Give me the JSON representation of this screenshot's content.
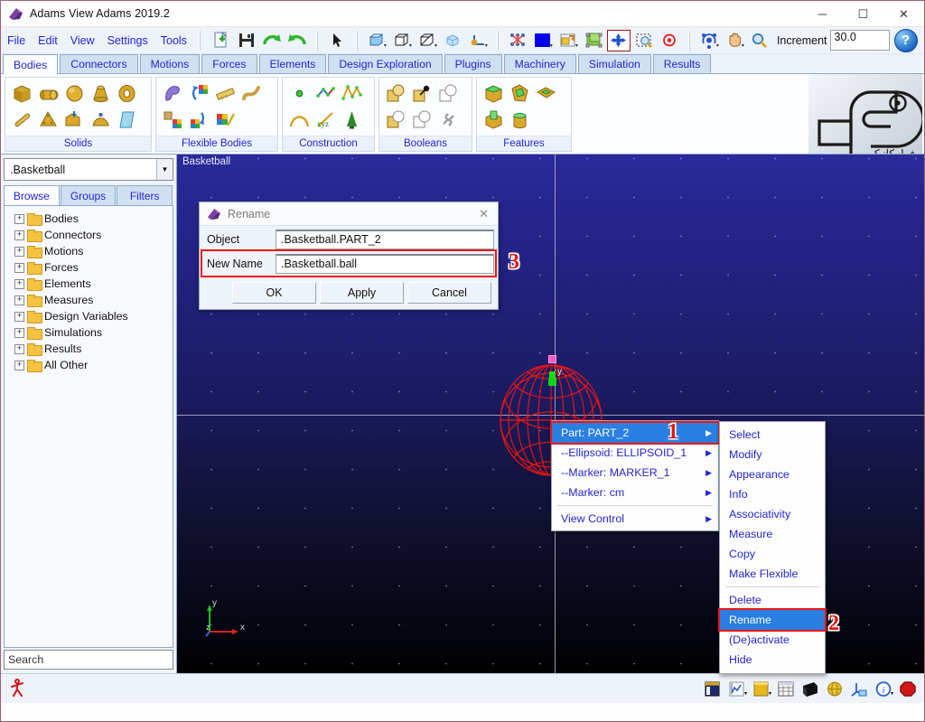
{
  "window": {
    "title": "Adams View Adams 2019.2",
    "icon": "adams-app-icon",
    "minimize": "─",
    "maximize": "☐",
    "close": "✕"
  },
  "menubar": {
    "items": [
      "File",
      "Edit",
      "View",
      "Settings",
      "Tools"
    ],
    "increment_label": "Increment",
    "increment_value": "30.0",
    "help_label": "?",
    "tools": [
      "new-file-icon",
      "save-icon",
      "redo-icon",
      "undo-icon",
      "select-arrow-icon",
      "front-view-icon",
      "wireframe-view-icon",
      "shaded-box-icon",
      "render-cube-icon",
      "coordinate-triad-icon",
      "grid-points-icon",
      "background-color-icon",
      "window-export-icon",
      "select-objects-icon",
      "translate-icon",
      "zoom-box-icon",
      "target-point-icon",
      "rotate-icon",
      "pan-hand-icon",
      "zoom-icon"
    ]
  },
  "ribbon": {
    "tabs": [
      "Bodies",
      "Connectors",
      "Motions",
      "Forces",
      "Elements",
      "Design Exploration",
      "Plugins",
      "Machinery",
      "Simulation",
      "Results"
    ],
    "active_tab": "Bodies",
    "panels": [
      {
        "label": "Solids",
        "icons": [
          "box-solid-icon",
          "cylinder-solid-icon",
          "sphere-solid-icon",
          "frustum-solid-icon",
          "torus-solid-icon",
          "link-solid-icon",
          "plate-solid-icon",
          "extrusion-solid-icon",
          "revolution-solid-icon",
          "rigid-plane-icon"
        ]
      },
      {
        "label": "Flexible Bodies",
        "icons": [
          "flex-body-icon",
          "rigid-to-flex-icon",
          "flex-beam-icon",
          "flex-spline-icon",
          "discrete-flex-link-icon",
          "flex-to-rigid-icon",
          "flex-modify-icon"
        ]
      },
      {
        "label": "Construction",
        "icons": [
          "point-icon",
          "polyline-icon",
          "spline-icon",
          "arc-icon",
          "xyz-csys-icon",
          "marker-icon"
        ]
      },
      {
        "label": "Booleans",
        "icons": [
          "unite-icon",
          "chamfer-icon",
          "intersect-icon",
          "subtract-icon",
          "merge-icon",
          "chain-icon"
        ]
      },
      {
        "label": "Features",
        "icons": [
          "fillet-icon",
          "hollow-icon",
          "hole-icon",
          "boss-icon",
          "extrude-feature-icon"
        ]
      }
    ],
    "watermark": "faramechanic-logo"
  },
  "sidebar": {
    "model_selector": ".Basketball",
    "tabs": [
      "Browse",
      "Groups",
      "Filters"
    ],
    "active_tab": "Browse",
    "tree": [
      "Bodies",
      "Connectors",
      "Motions",
      "Forces",
      "Elements",
      "Measures",
      "Design Variables",
      "Simulations",
      "Results",
      "All Other"
    ],
    "expander_glyph": "+",
    "search_placeholder": "Search"
  },
  "viewport": {
    "label": "Basketball",
    "axis_labels": {
      "x": "x",
      "y": "y",
      "z": "z"
    },
    "body_marker_label": "y"
  },
  "dialog": {
    "title": "Rename",
    "icon": "adams-app-icon",
    "close_glyph": "✕",
    "fields": [
      {
        "label": "Object",
        "value": ".Basketball.PART_2",
        "highlighted": false
      },
      {
        "label": "New Name",
        "value": ".Basketball.ball",
        "highlighted": true
      }
    ],
    "buttons": [
      "OK",
      "Apply",
      "Cancel"
    ]
  },
  "context_menu_object": {
    "items": [
      {
        "label": "Part: PART_2",
        "selected": true,
        "submenu": true
      },
      {
        "label": "--Ellipsoid: ELLIPSOID_1",
        "selected": false,
        "submenu": true
      },
      {
        "label": "--Marker: MARKER_1",
        "selected": false,
        "submenu": true
      },
      {
        "label": "--Marker: cm",
        "selected": false,
        "submenu": true
      },
      {
        "separator": true
      },
      {
        "label": "View Control",
        "selected": false,
        "submenu": true
      }
    ],
    "submenu_glyph": "▶"
  },
  "context_menu_actions": {
    "items": [
      {
        "label": "Select",
        "selected": false
      },
      {
        "label": "Modify",
        "selected": false
      },
      {
        "label": "Appearance",
        "selected": false
      },
      {
        "label": "Info",
        "selected": false
      },
      {
        "label": "Associativity",
        "selected": false
      },
      {
        "label": "Measure",
        "selected": false
      },
      {
        "label": "Copy",
        "selected": false
      },
      {
        "label": "Make Flexible",
        "selected": false
      },
      {
        "separator": true
      },
      {
        "label": "Delete",
        "selected": false
      },
      {
        "label": "Rename",
        "selected": true
      },
      {
        "label": "(De)activate",
        "selected": false
      },
      {
        "label": "Hide",
        "selected": false
      }
    ]
  },
  "annotations": [
    {
      "number": "1",
      "target": "context-menu-part-item"
    },
    {
      "number": "2",
      "target": "context-menu-rename-item"
    },
    {
      "number": "3",
      "target": "dialog-new-name-field"
    }
  ],
  "statusbar": {
    "left_icon": "running-man-icon",
    "icons": [
      "model-browser-icon",
      "plot-icon",
      "note-icon",
      "table-icon",
      "shade-icon",
      "render-globe-icon",
      "coordinate-display-icon",
      "info-icon",
      "stop-icon"
    ]
  },
  "colors": {
    "accent_blue": "#2525cc",
    "highlight_red": "#f01414",
    "selection_blue": "#2a7fe0",
    "viewport_top": "#2a2a9c",
    "viewport_bottom": "#000000",
    "ball_wire": "#e81414",
    "marker_green": "#16e016",
    "marker_pink": "#ff57c8",
    "folder_yellow": "#f5c242"
  }
}
